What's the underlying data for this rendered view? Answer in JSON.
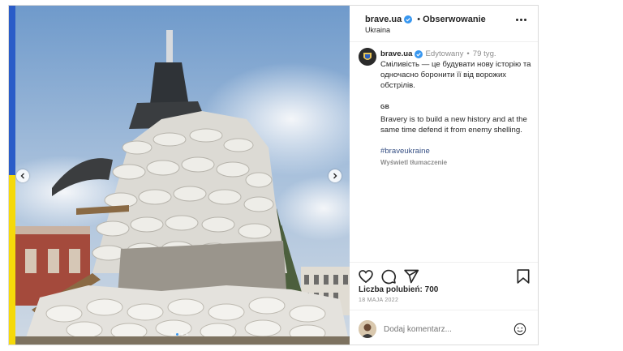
{
  "header": {
    "username": "brave.ua",
    "separator": "•",
    "follow_label": "Obserwowanie",
    "location": "Ukraina"
  },
  "caption": {
    "username": "brave.ua",
    "edited_label": "Edytowany",
    "separator": "•",
    "time_ago": "79 tyg.",
    "text_ua": "Сміливість — це будувати нову історію та одночасно боронити її від ворожих обстрілів.",
    "lang_tag": "GB",
    "text_en": "Bravery is to build a new history and at the same time defend it from enemy shelling.",
    "hashtag": "#braveukraine",
    "translate_label": "Wyświetl tłumaczenie"
  },
  "likes": "Liczba polubień: 700",
  "date": "18 MAJA 2022",
  "comment": {
    "placeholder": "Dodaj komentarz..."
  },
  "icons": {
    "verified": "verified-badge-icon",
    "like": "heart-icon",
    "comment": "comment-icon",
    "share": "paper-plane-icon",
    "save": "bookmark-icon",
    "emoji": "smiley-icon",
    "prev": "chevron-left-icon",
    "next": "chevron-right-icon"
  },
  "colors": {
    "verified": "#3897f0",
    "flag_blue": "#2a5cc8",
    "flag_yellow": "#f5d90a",
    "hashtag": "#385185",
    "muted": "#8e8e8e"
  },
  "carousel": {
    "slide_count": 4,
    "active_index": 1
  }
}
